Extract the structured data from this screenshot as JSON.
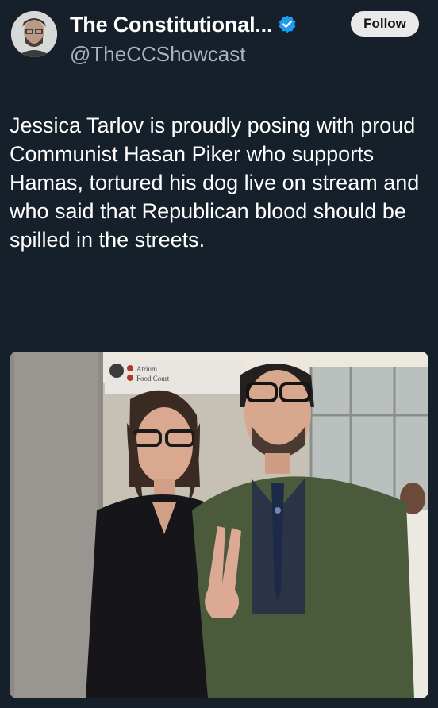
{
  "author": {
    "display_name": "The Constitutional...",
    "handle": "@TheCCShowcast",
    "verified_icon": "verified-badge-icon",
    "badge_color": "#1d9bf0"
  },
  "follow_button": {
    "label": "Follow"
  },
  "tweet": {
    "text": "Jessica Tarlov is proudly posing with proud Communist Hasan Piker who supports Hamas, tortured his dog live on stream and who said that Republican blood should be spilled in the streets."
  },
  "media": {
    "sign_lines": [
      "Atrium",
      "Food Court"
    ]
  },
  "colors": {
    "background": "#15202b",
    "text": "#ffffff",
    "secondary_text": "#a9b4bd"
  }
}
